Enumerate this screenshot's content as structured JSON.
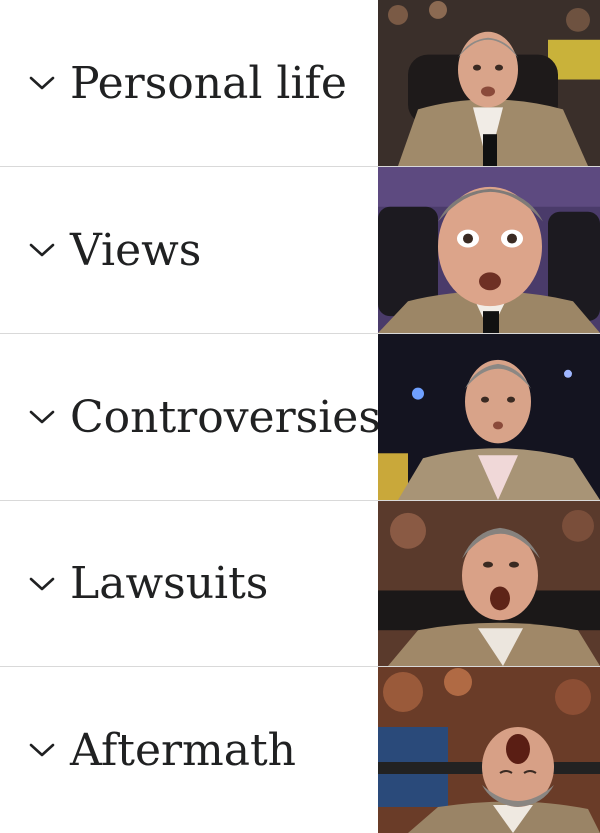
{
  "sections": [
    {
      "label": "Personal life",
      "icon": "chevron-down-icon"
    },
    {
      "label": "Views",
      "icon": "chevron-down-icon"
    },
    {
      "label": "Controversies",
      "icon": "chevron-down-icon"
    },
    {
      "label": "Lawsuits",
      "icon": "chevron-down-icon"
    },
    {
      "label": "Aftermath",
      "icon": "chevron-down-icon"
    }
  ],
  "colors": {
    "text": "#202122",
    "divider": "#d9d9d9",
    "chevron": "#202122"
  },
  "reaction_panels": [
    {
      "stage": 1,
      "expression": "neutral-surprised"
    },
    {
      "stage": 2,
      "expression": "wide-eyed-shock"
    },
    {
      "stage": 3,
      "expression": "intrigued"
    },
    {
      "stage": 4,
      "expression": "mouth-open-leaning-back"
    },
    {
      "stage": 5,
      "expression": "head-thrown-back-ecstatic"
    }
  ]
}
